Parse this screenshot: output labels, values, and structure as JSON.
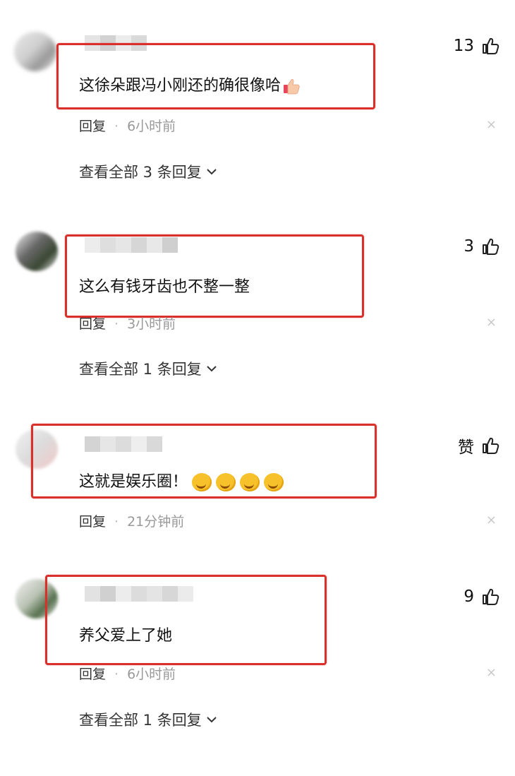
{
  "comments": [
    {
      "text": "这徐朵跟冯小刚还的确很像哈",
      "reply_label": "回复",
      "time": "6小时前",
      "likes": "13",
      "view_replies": "查看全部 3 条回复",
      "close": "×"
    },
    {
      "text": "这么有钱牙齿也不整一整",
      "reply_label": "回复",
      "time": "3小时前",
      "likes": "3",
      "view_replies": "查看全部 1 条回复",
      "close": "×"
    },
    {
      "text": "这就是娱乐圈！",
      "reply_label": "回复",
      "time": "21分钟前",
      "likes": "赞",
      "close": "×"
    },
    {
      "text": "养父爱上了她",
      "reply_label": "回复",
      "time": "6小时前",
      "likes": "9",
      "view_replies": "查看全部 1 条回复",
      "close": "×"
    }
  ],
  "icons": {
    "like": "thumbs-up-icon",
    "expand": "chevron-down-icon",
    "close": "close-icon",
    "emoji_thumb": "thumbs-up-emoji-icon",
    "emoji_smile": "smirk-emoji-icon"
  },
  "colors": {
    "highlight_box": "#d9302c",
    "meta_time": "#999999",
    "background": "#ffffff"
  }
}
